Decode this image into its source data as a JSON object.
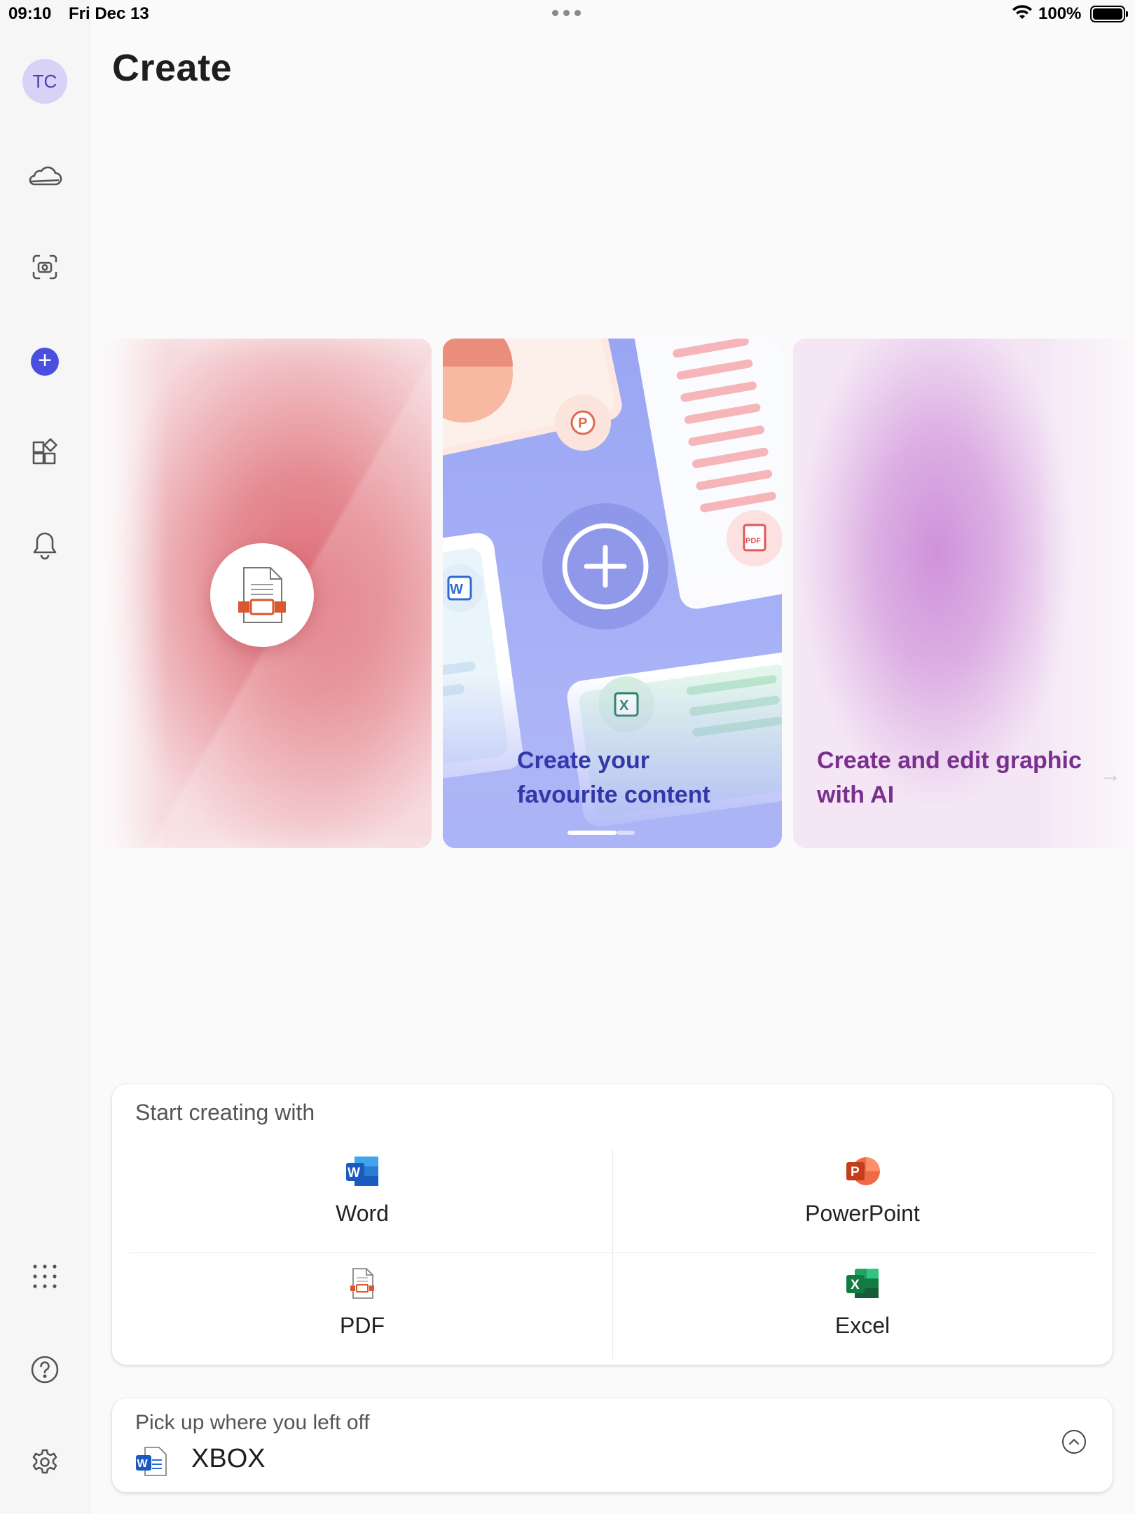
{
  "status_bar": {
    "time": "09:10",
    "date": "Fri Dec 13",
    "battery": "100%"
  },
  "sidebar": {
    "avatar_initials": "TC",
    "items": [
      {
        "icon": "cloud-icon"
      },
      {
        "icon": "camera-scan-icon"
      },
      {
        "icon": "plus-circle-icon",
        "active": true
      },
      {
        "icon": "apps-grid-icon"
      },
      {
        "icon": "bell-icon"
      }
    ],
    "bottom_items": [
      {
        "icon": "dots-grid-icon"
      },
      {
        "icon": "help-icon"
      },
      {
        "icon": "settings-icon"
      }
    ],
    "accent_color": "#4a4fe0"
  },
  "page": {
    "title": "Create"
  },
  "carousel": {
    "cards": [
      {
        "caption": "",
        "icon": "pdf-create-icon"
      },
      {
        "caption_line1": "Create your",
        "caption_line2": "favourite content"
      },
      {
        "caption_line1": "Create and edit graphic",
        "caption_line2": "with AI"
      }
    ]
  },
  "start_creating": {
    "heading": "Start creating with",
    "apps": [
      {
        "label": "Word",
        "icon": "word-icon"
      },
      {
        "label": "PowerPoint",
        "icon": "powerpoint-icon"
      },
      {
        "label": "PDF",
        "icon": "pdf-icon"
      },
      {
        "label": "Excel",
        "icon": "excel-icon"
      }
    ]
  },
  "pickup": {
    "heading": "Pick up where you left off",
    "file_name": "XBOX",
    "file_icon": "word-icon"
  }
}
